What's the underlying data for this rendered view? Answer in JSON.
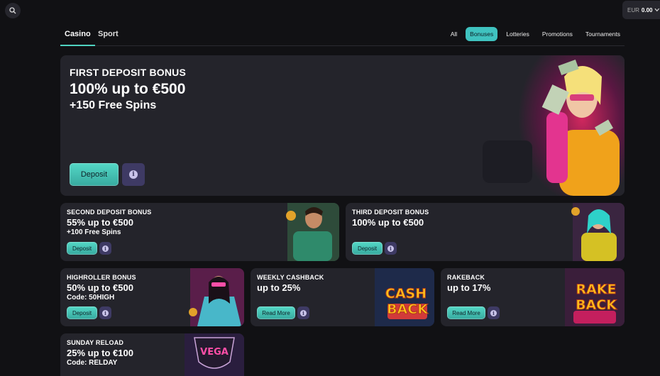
{
  "header": {
    "search_icon": "search-icon",
    "currency": "EUR",
    "balance": "0.00"
  },
  "main_tabs": [
    {
      "label": "Casino",
      "active": true
    },
    {
      "label": "Sport",
      "active": false
    }
  ],
  "filters": [
    {
      "label": "All",
      "active": false
    },
    {
      "label": "Bonuses",
      "active": true
    },
    {
      "label": "Lotteries",
      "active": false
    },
    {
      "label": "Promotions",
      "active": false
    },
    {
      "label": "Tournaments",
      "active": false
    }
  ],
  "hero": {
    "title": "FIRST DEPOSIT BONUS",
    "amount": "100% up to €500",
    "extra": "+150 Free Spins",
    "button": "Deposit"
  },
  "cards": [
    {
      "title": "SECOND DEPOSIT BONUS",
      "amount": "55% up to €500",
      "extra": "+100 Free Spins",
      "button": "Deposit"
    },
    {
      "title": "THIRD DEPOSIT BONUS",
      "amount": "100% up to €500",
      "extra": "",
      "button": "Deposit"
    },
    {
      "title": "HIGHROLLER BONUS",
      "amount": "50% up to €500",
      "extra": "Code: 50HIGH",
      "button": "Deposit"
    },
    {
      "title": "WEEKLY CASHBACK",
      "amount": "up to 25%",
      "extra": "",
      "button": "Read More",
      "art_line1": "CASH",
      "art_line2": "BACK"
    },
    {
      "title": "RAKEBACK",
      "amount": "up to 17%",
      "extra": "",
      "button": "Read More",
      "art_line1": "RAKE",
      "art_line2": "BACK"
    },
    {
      "title": "SUNDAY RELOAD",
      "amount": "25% up to €100",
      "extra": "Code: RELDAY",
      "button": "",
      "art_label": "VEGA"
    }
  ],
  "colors": {
    "accent": "#3fc2bf",
    "card": "#24242b",
    "background": "#111114",
    "info": "#3e3a64"
  }
}
